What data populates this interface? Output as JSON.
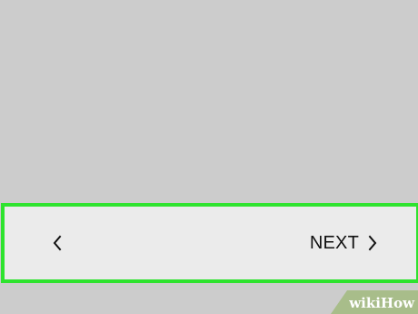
{
  "navigation": {
    "back_icon": "chevron-left-icon",
    "next_label": "NEXT",
    "next_icon": "chevron-right-icon"
  },
  "colors": {
    "background": "#cccccc",
    "nav_bar_background": "#ebebeb",
    "highlight_border": "#2ee32e",
    "watermark_background": "#a8bd8a"
  },
  "watermark": {
    "text_prefix": "wiki",
    "text_suffix": "How"
  }
}
